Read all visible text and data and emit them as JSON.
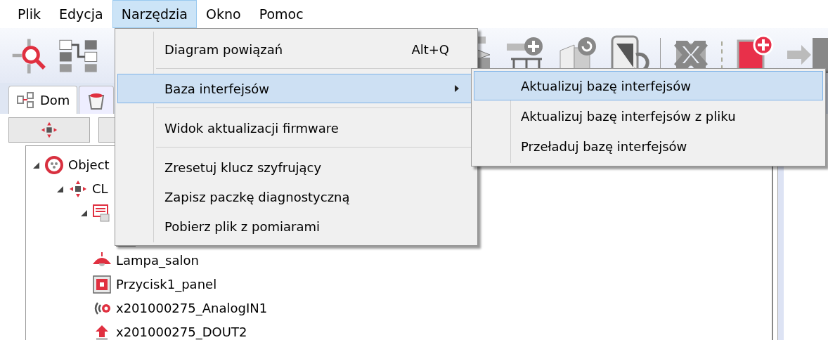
{
  "menubar": [
    {
      "label": "Plik",
      "selected": false
    },
    {
      "label": "Edycja",
      "selected": false
    },
    {
      "label": "Narzędzia",
      "selected": true
    },
    {
      "label": "Okno",
      "selected": false
    },
    {
      "label": "Pomoc",
      "selected": false
    }
  ],
  "tabs": [
    {
      "kind": "home",
      "label": "Dom",
      "selected": true
    },
    {
      "kind": "bin",
      "selected": false
    }
  ],
  "tree": [
    {
      "kind": "objects",
      "label": "Object",
      "expanded": true,
      "children": [
        {
          "kind": "cluster",
          "label": "CL",
          "expanded": true,
          "children": [
            {
              "kind": "module",
              "expanded": true,
              "children": [
                {
                  "kind": "script"
                }
              ]
            },
            {
              "kind": "lamp",
              "label": "Lampa_salon"
            },
            {
              "kind": "button",
              "label": "Przycisk1_panel"
            },
            {
              "kind": "analog",
              "label": "x201000275_AnalogIN1"
            },
            {
              "kind": "output",
              "label": "x201000275_DOUT2"
            }
          ]
        }
      ]
    }
  ],
  "tools_menu": [
    {
      "kind": "item",
      "label": "Diagram powiązań",
      "shortcut": "Alt+Q",
      "selected": false
    },
    {
      "kind": "separator"
    },
    {
      "kind": "submenu",
      "label": "Baza interfejsów",
      "selected": true
    },
    {
      "kind": "separator"
    },
    {
      "kind": "item",
      "label": "Widok aktualizacji firmware",
      "selected": false
    },
    {
      "kind": "separator"
    },
    {
      "kind": "item",
      "label": "Zresetuj klucz szyfrujący",
      "selected": false
    },
    {
      "kind": "item",
      "label": "Zapisz paczkę diagnostyczną",
      "selected": false
    },
    {
      "kind": "item",
      "label": "Pobierz plik z pomiarami",
      "selected": false
    }
  ],
  "submenu": [
    {
      "label": "Aktualizuj bazę interfejsów",
      "selected": true
    },
    {
      "label": "Aktualizuj bazę interfejsów z pliku",
      "selected": false
    },
    {
      "label": "Przeładuj bazę interfejsów",
      "selected": false
    }
  ]
}
